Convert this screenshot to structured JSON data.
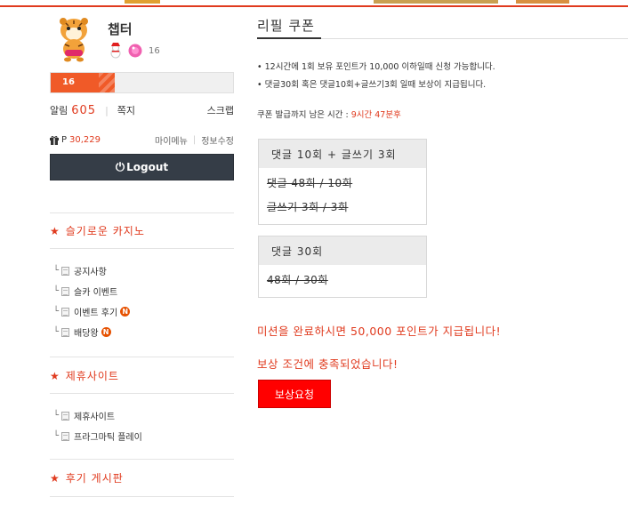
{
  "colors": {
    "accent": "#e03a1e",
    "button": "#ff0000",
    "logout_bg": "#353d47"
  },
  "profile": {
    "nickname": "챕터",
    "avatar_icon": "tiger-mascot-icon",
    "badge_icons": [
      "snowman-icon",
      "pink-ball-icon"
    ],
    "badge_count": "16",
    "level": "16",
    "level_progress_percent": 35
  },
  "alarm": {
    "label": "알림",
    "count": "605",
    "note_label": "쪽지",
    "scrap_label": "스크랩"
  },
  "points": {
    "icon": "gift-icon",
    "prefix": "P",
    "value": "30,229",
    "mymenu_label": "마이메뉴",
    "edit_label": "정보수정"
  },
  "logout": {
    "label": "Logout",
    "icon": "power-icon"
  },
  "sections": [
    {
      "title": "슬기로운 카지노",
      "items": [
        {
          "label": "공지사항",
          "new": false
        },
        {
          "label": "슬카 이벤트",
          "new": false
        },
        {
          "label": "이벤트 후기",
          "new": true
        },
        {
          "label": "배당왕",
          "new": true
        }
      ]
    },
    {
      "title": "제휴사이트",
      "items": [
        {
          "label": "제휴사이트",
          "new": false
        },
        {
          "label": "프라그마틱 플레이",
          "new": false
        }
      ]
    },
    {
      "title": "후기 게시판",
      "items": []
    }
  ],
  "new_badge_text": "N",
  "main": {
    "title": "리필 쿠폰",
    "notices": [
      "• 12시간에 1회 보유 포인트가 10,000 이하일때 신청 가능합니다.",
      "• 댓글30회 혹은 댓글10회+글쓰기3회 일때 보상이 지급됩니다."
    ],
    "remain_label": "쿠폰 발급까지 남은 시간 : ",
    "remain_time": "9시간 47분후",
    "missions": [
      {
        "header": "댓글 10회 + 글쓰기 3회",
        "rows": [
          "댓글 48회 / 10회",
          "글쓰기 3회 / 3회"
        ]
      },
      {
        "header": "댓글 30회",
        "rows": [
          "48회 / 30회"
        ]
      }
    ],
    "complete_message": "미션을 완료하시면 50,000 포인트가 지급됩니다!",
    "condition_message": "보상 조건에 충족되었습니다!",
    "request_button": "보상요청"
  }
}
